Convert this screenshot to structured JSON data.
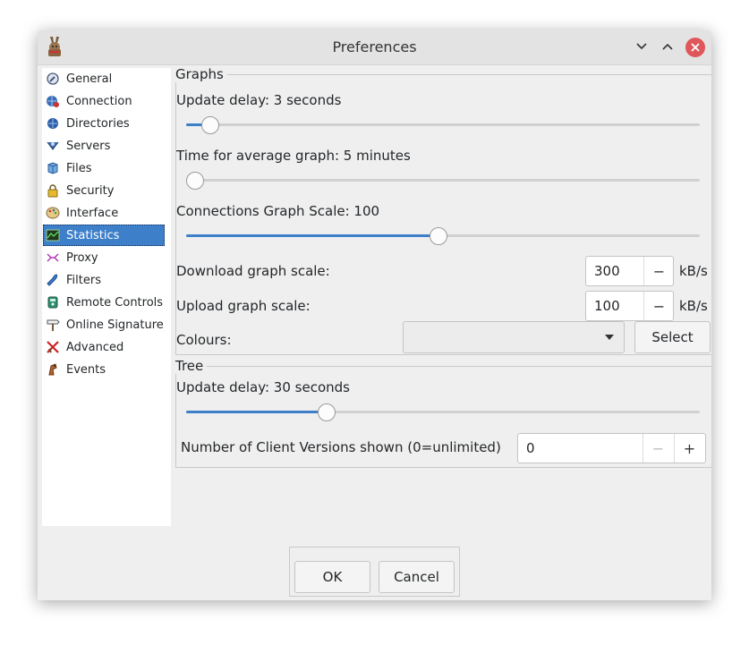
{
  "window": {
    "title": "Preferences",
    "app_icon": "amule-donkey-icon"
  },
  "titlebar_buttons": [
    "minimize",
    "maximize",
    "close"
  ],
  "sidebar": {
    "selected": "Statistics",
    "items": [
      {
        "label": "General",
        "icon": "wrench-icon"
      },
      {
        "label": "Connection",
        "icon": "connection-icon"
      },
      {
        "label": "Directories",
        "icon": "folder-icon"
      },
      {
        "label": "Servers",
        "icon": "server-icon"
      },
      {
        "label": "Files",
        "icon": "files-icon"
      },
      {
        "label": "Security",
        "icon": "lock-icon"
      },
      {
        "label": "Interface",
        "icon": "palette-icon"
      },
      {
        "label": "Statistics",
        "icon": "statistics-icon"
      },
      {
        "label": "Proxy",
        "icon": "proxy-icon"
      },
      {
        "label": "Filters",
        "icon": "filter-icon"
      },
      {
        "label": "Remote Controls",
        "icon": "remote-icon"
      },
      {
        "label": "Online Signature",
        "icon": "signpost-icon"
      },
      {
        "label": "Advanced",
        "icon": "advanced-icon"
      },
      {
        "label": "Events",
        "icon": "events-icon"
      }
    ]
  },
  "graphs": {
    "title": "Graphs",
    "update_delay_label": "Update delay: 3 seconds",
    "update_delay_fraction": 0.03,
    "average_time_label": "Time for average graph: 5 minutes",
    "average_time_fraction": 0.0,
    "connections_scale_label": "Connections Graph Scale: 100",
    "connections_scale_fraction": 0.49,
    "download_scale_label": "Download graph scale:",
    "download_scale_value": "300",
    "upload_scale_label": "Upload graph scale:",
    "upload_scale_value": "100",
    "unit": "kB/s",
    "colours_label": "Colours:",
    "colours_value": "",
    "select_label": "Select"
  },
  "tree": {
    "title": "Tree",
    "update_delay_label": "Update delay: 30 seconds",
    "update_delay_fraction": 0.265,
    "client_versions_label": "Number of Client Versions shown (0=unlimited)",
    "client_versions_value": "0"
  },
  "spin_symbols": {
    "minus": "−",
    "plus": "+"
  },
  "footer": {
    "ok_label": "OK",
    "cancel_label": "Cancel"
  },
  "colors": {
    "accent": "#3d7fc9",
    "close_button": "#e0575b"
  }
}
